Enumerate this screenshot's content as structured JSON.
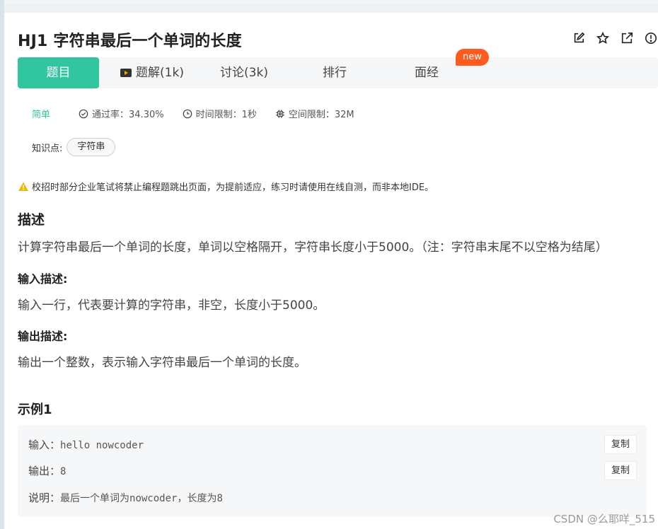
{
  "problem": {
    "title": "HJ1  字符串最后一个单词的长度"
  },
  "header_icons": [
    "edit-icon",
    "star-icon",
    "external-link-icon",
    "info-icon"
  ],
  "tabs": [
    {
      "label": "题目",
      "active": true
    },
    {
      "label": "题解(1k)",
      "icon": "video-icon"
    },
    {
      "label": "讨论(3k)"
    },
    {
      "label": "排行"
    },
    {
      "label": "面经"
    }
  ],
  "new_badge": "new",
  "meta": {
    "level": "简单",
    "pass_rate": "通过率：34.30%",
    "time_limit": "时间限制：1秒",
    "space_limit": "空间限制：32M"
  },
  "knowledge": {
    "label": "知识点:",
    "tags": [
      "字符串"
    ]
  },
  "warning": "校招时部分企业笔试将禁止编程题跳出页面，为提前适应，练习时请使用在线自测，而非本地IDE。",
  "description": {
    "heading": "描述",
    "text": "计算字符串最后一个单词的长度，单词以空格隔开，字符串长度小于5000。（注：字符串末尾不以空格为结尾）"
  },
  "input_desc": {
    "heading": "输入描述:",
    "text": "输入一行，代表要计算的字符串，非空，长度小于5000。"
  },
  "output_desc": {
    "heading": "输出描述:",
    "text": "输出一个整数，表示输入字符串最后一个单词的长度。"
  },
  "example": {
    "heading": "示例1",
    "input_label": "输入：",
    "input_value": "hello nowcoder",
    "output_label": "输出：",
    "output_value": "8",
    "explain_label": "说明：",
    "explain_value": "最后一个单词为nowcoder，长度为8",
    "copy_label": "复制"
  },
  "watermark": "CSDN @么耶咩_515",
  "colors": {
    "accent": "#32c6a0",
    "badge": "#ff5b1f",
    "warning": "#f2b705"
  }
}
